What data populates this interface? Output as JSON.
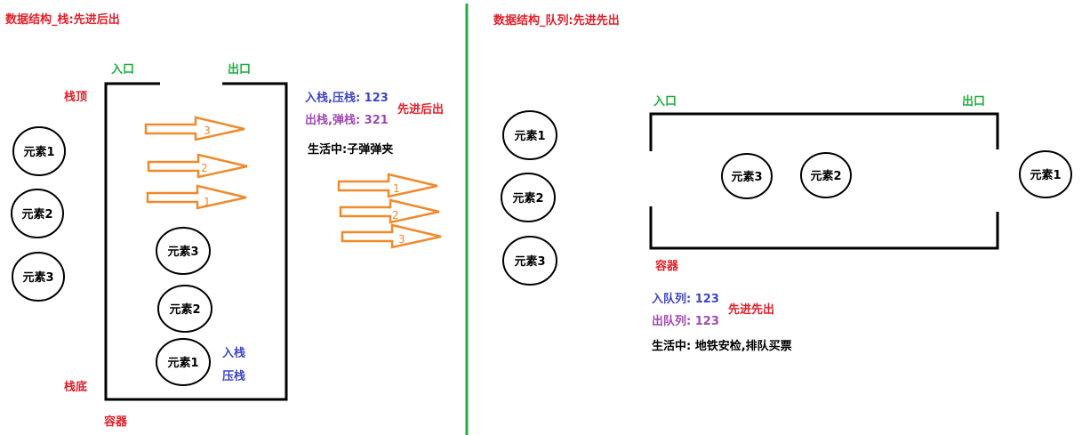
{
  "stack": {
    "title": "数据结构_栈:先进后出",
    "entry": "入口",
    "exit": "出口",
    "top": "栈顶",
    "bottom": "栈底",
    "container": "容器",
    "push_ops": "入栈,压栈: 123",
    "pop_ops": "出栈,弹栈:  321",
    "lifo": "先进后出",
    "life": "生活中:子弹弹夹",
    "push_label": "入栈",
    "press_label": "压栈",
    "outside_elements": [
      "元素1",
      "元素2",
      "元素3"
    ],
    "inside_elements": [
      "元素3",
      "元素2",
      "元素1"
    ],
    "in_arrow_numbers": [
      "3",
      "2",
      "1"
    ],
    "out_arrow_numbers": [
      "1",
      "2",
      "3"
    ]
  },
  "queue": {
    "title": "数据结构_队列:先进先出",
    "entry": "入口",
    "exit": "出口",
    "container": "容器",
    "enqueue": "入队列: 123",
    "dequeue": "出队列: 123",
    "fifo": "先进先出",
    "life": "生活中: 地铁安检,排队买票",
    "waiting_elements": [
      "元素1",
      "元素2",
      "元素3"
    ],
    "inside_elements": [
      "元素3",
      "元素2"
    ],
    "exited_element": "元素1"
  },
  "colors": {
    "red": "#e0202a",
    "green": "#1fae3c",
    "blue": "#3f46c4",
    "purple": "#a048b4",
    "arrow_orange": "#f08a2c",
    "divider_green": "#1fae3c"
  }
}
